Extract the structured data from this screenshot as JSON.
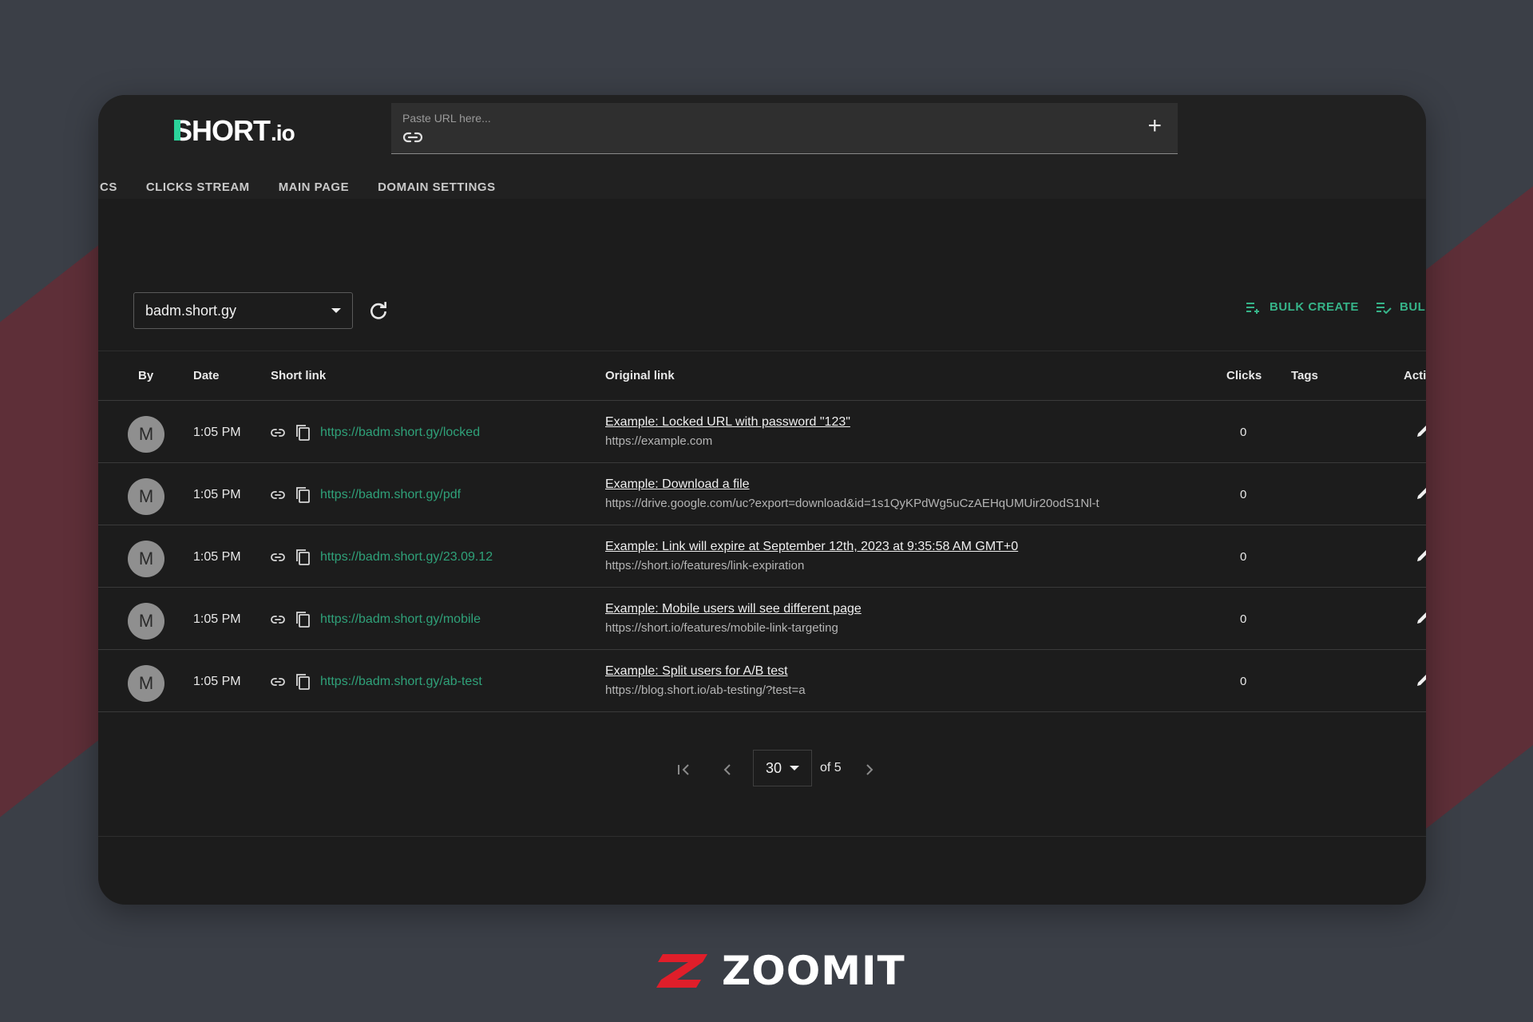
{
  "brand": {
    "logo_main": "HORT",
    "logo_first": "S",
    "logo_suffix": ".io"
  },
  "url_input": {
    "placeholder": "Paste URL here...",
    "add_icon": "plus-icon"
  },
  "tabs": [
    {
      "label": "CS"
    },
    {
      "label": "CLICKS STREAM"
    },
    {
      "label": "MAIN PAGE"
    },
    {
      "label": "DOMAIN SETTINGS"
    }
  ],
  "domain_select": {
    "value": "badm.short.gy"
  },
  "actions": {
    "bulk_create": "BULK CREATE",
    "bulk_edit": "BULI"
  },
  "table": {
    "headers": {
      "by": "By",
      "date": "Date",
      "short": "Short link",
      "original": "Original link",
      "clicks": "Clicks",
      "tags": "Tags",
      "actions": "Acti"
    },
    "rows": [
      {
        "avatar": "M",
        "date": "1:05 PM",
        "short": "https://badm.short.gy/locked",
        "title": "Example: Locked URL with password \"123\"",
        "url": "https://example.com",
        "clicks": "0"
      },
      {
        "avatar": "M",
        "date": "1:05 PM",
        "short": "https://badm.short.gy/pdf",
        "title": "Example: Download a file",
        "url": "https://drive.google.com/uc?export=download&id=1s1QyKPdWg5uCzAEHqUMUir20odS1Nl-t",
        "clicks": "0"
      },
      {
        "avatar": "M",
        "date": "1:05 PM",
        "short": "https://badm.short.gy/23.09.12",
        "title": "Example: Link will expire at September 12th, 2023 at 9:35:58 AM GMT+0",
        "url": "https://short.io/features/link-expiration",
        "clicks": "0"
      },
      {
        "avatar": "M",
        "date": "1:05 PM",
        "short": "https://badm.short.gy/mobile",
        "title": "Example: Mobile users will see different page",
        "url": "https://short.io/features/mobile-link-targeting",
        "clicks": "0"
      },
      {
        "avatar": "M",
        "date": "1:05 PM",
        "short": "https://badm.short.gy/ab-test",
        "title": "Example: Split users for A/B test",
        "url": "https://blog.short.io/ab-testing/?test=a",
        "clicks": "0"
      }
    ]
  },
  "pagination": {
    "page_size": "30",
    "of_label": "of 5"
  },
  "watermark": {
    "text": "ZOOMIT"
  },
  "colors": {
    "accent": "#2fa179",
    "logo_green": "#2bd39a",
    "watermark_red": "#e01e2a"
  }
}
